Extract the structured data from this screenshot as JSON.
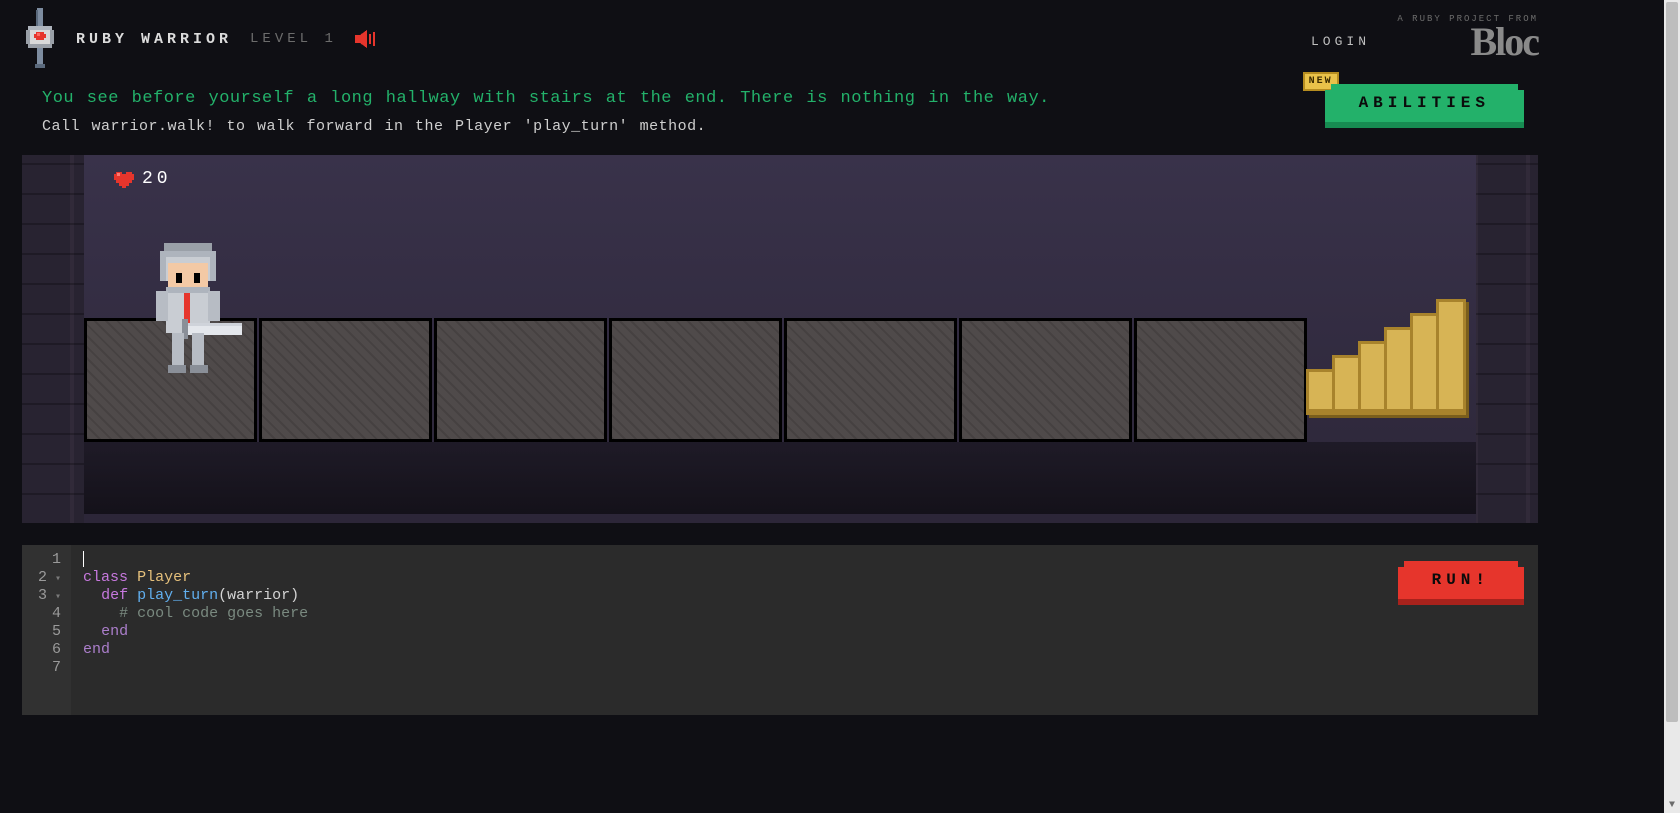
{
  "header": {
    "title": "RUBY WARRIOR",
    "level_label": "LEVEL 1",
    "login_label": "LOGIN",
    "bloc_tagline": "A RUBY PROJECT FROM",
    "bloc_brand": "Bloc"
  },
  "instructions": {
    "line_main": "You see before yourself a long hallway with stairs at the end. There is nothing in the way.",
    "line_hint": "Call warrior.walk! to walk forward in the Player 'play_turn' method."
  },
  "buttons": {
    "abilities": "ABILITIES",
    "abilities_badge": "NEW",
    "run": "RUN!"
  },
  "game": {
    "hp": "20",
    "tile_count": 7
  },
  "code": {
    "line_numbers": [
      "1",
      "2",
      "3",
      "4",
      "5",
      "6",
      "7"
    ],
    "tokens": {
      "class_kw": "class",
      "class_name": "Player",
      "def_kw": "def",
      "method_name": "play_turn",
      "method_args": "(warrior)",
      "comment": "# cool code goes here",
      "end1": "end",
      "end2": "end"
    }
  }
}
